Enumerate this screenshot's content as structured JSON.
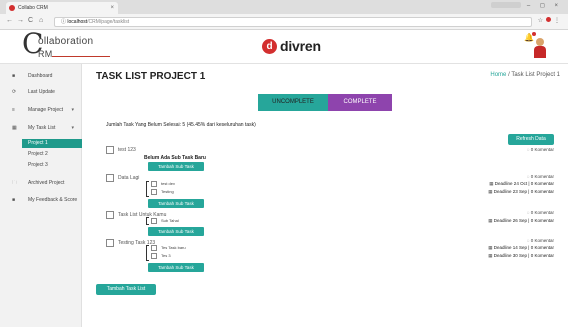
{
  "browser": {
    "tab_title": "Collabo CRM",
    "tab_close": "×",
    "nav_back": "←",
    "nav_forward": "→",
    "nav_reload": "C",
    "nav_home": "⌂",
    "url_host": "localhost",
    "url_path": "/CRM/page/tasklist",
    "url_icon": "ⓘ",
    "window_controls": "–  ◻  ×",
    "star_icon": "☆"
  },
  "logo": {
    "big_letter": "C",
    "top_text": "ollaboration",
    "bottom_text": "RM"
  },
  "brand": {
    "mark": "d",
    "name": "divren"
  },
  "sidebar": {
    "items": [
      {
        "label": "Dashboard",
        "icon": "■"
      },
      {
        "label": "Last Update",
        "icon": "⟳"
      },
      {
        "label": "Manage Project",
        "icon": "≡",
        "caret": "▾"
      },
      {
        "label": "My Task List",
        "icon": "▦",
        "caret": "▾"
      },
      {
        "label": "Archived Project",
        "icon": "🗀"
      },
      {
        "label": "My Feedback & Score",
        "icon": "■"
      }
    ],
    "sub_items": [
      {
        "label": "Project 1"
      },
      {
        "label": "Project 2"
      },
      {
        "label": "Project 3"
      }
    ]
  },
  "main": {
    "title": "TASK LIST PROJECT 1",
    "breadcrumb_home": "Home",
    "breadcrumb_sep": " / ",
    "breadcrumb_current": "Task List Project 1",
    "toggle_uncomplete": "UNCOMPLETE",
    "toggle_complete": "COMPLETE",
    "summary": "Jumlah Task Yang Belum Selesai: 5 (45.45% dari keseluruhan task)",
    "refresh_label": "Refresh Data",
    "add_task_label": "Tambah Task List",
    "add_sub_label": "Tambah Sub Task",
    "tasks": [
      {
        "name": "test 123",
        "comments": "0 Komentar",
        "sub_title": "Belum Ada Sub Task Baru",
        "subtasks": [],
        "deadlines": []
      },
      {
        "name": "Data Lagi",
        "comments": "0 Komentar",
        "sub_title": "",
        "subtasks": [
          {
            "name": "test dev"
          },
          {
            "name": "Testing"
          }
        ],
        "deadlines": [
          "Deadline 24 Oct | 0 Komentar",
          "Deadline 23 Sep | 0 Komentar"
        ]
      },
      {
        "name": "Task List Untuk Kamu",
        "comments": "0 Komentar",
        "sub_title": "",
        "subtasks": [
          {
            "name": "Sub Tahal"
          }
        ],
        "deadlines": [
          "Deadline 26 Sep | 0 Komentar"
        ]
      },
      {
        "name": "Testing Task 123",
        "comments": "0 Komentar",
        "sub_title": "",
        "subtasks": [
          {
            "name": "Tes Task baru"
          },
          {
            "name": "Tes 3"
          }
        ],
        "deadlines": [
          "Deadline 14 Sep | 0 Komentar",
          "Deadline 30 Sep | 0 Komentar"
        ]
      }
    ]
  },
  "colors": {
    "accent": "#26a69a",
    "complete": "#8e44ad",
    "brand_red": "#d32f2f"
  }
}
